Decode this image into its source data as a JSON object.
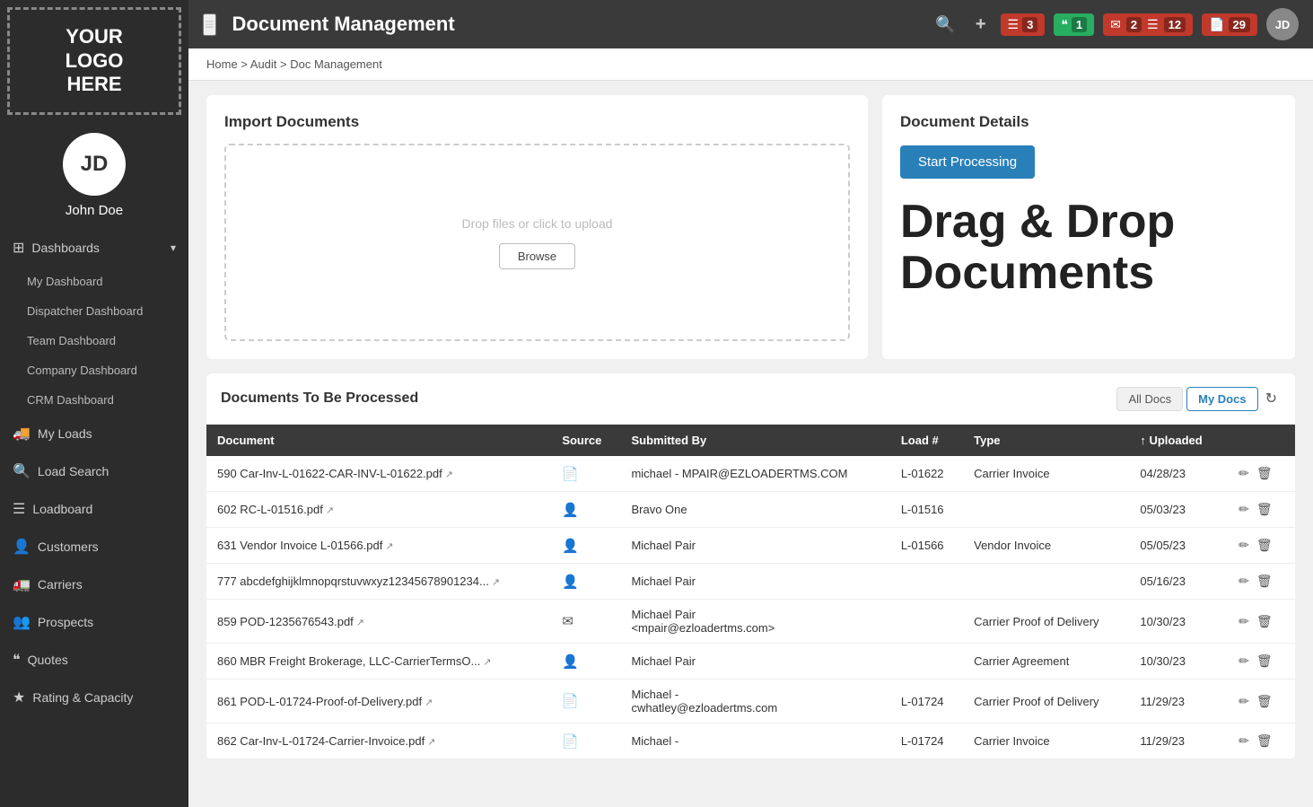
{
  "sidebar": {
    "logo": "YOUR\nLOGO\nHERE",
    "user": {
      "initials": "JD",
      "name": "John Doe"
    },
    "nav": [
      {
        "id": "dashboards",
        "icon": "grid",
        "label": "Dashboards",
        "hasChevron": true,
        "expanded": true,
        "subItems": [
          {
            "id": "my-dashboard",
            "label": "My Dashboard"
          },
          {
            "id": "dispatcher-dashboard",
            "label": "Dispatcher Dashboard"
          },
          {
            "id": "team-dashboard",
            "label": "Team Dashboard"
          },
          {
            "id": "company-dashboard",
            "label": "Company Dashboard"
          },
          {
            "id": "crm-dashboard",
            "label": "CRM Dashboard"
          }
        ]
      },
      {
        "id": "my-loads",
        "icon": "truck",
        "label": "My Loads"
      },
      {
        "id": "load-search",
        "icon": "search",
        "label": "Load Search"
      },
      {
        "id": "loadboard",
        "icon": "list",
        "label": "Loadboard"
      },
      {
        "id": "customers",
        "icon": "user",
        "label": "Customers"
      },
      {
        "id": "carriers",
        "icon": "truck2",
        "label": "Carriers"
      },
      {
        "id": "prospects",
        "icon": "users",
        "label": "Prospects"
      },
      {
        "id": "quotes",
        "icon": "quote",
        "label": "Quotes"
      },
      {
        "id": "rating-capacity",
        "icon": "star",
        "label": "Rating & Capacity"
      }
    ]
  },
  "topbar": {
    "hamburger_label": "≡",
    "page_title": "Document Management",
    "search_icon": "🔍",
    "add_icon": "+",
    "badge_groups": [
      {
        "id": "list-badge",
        "icon": "≡",
        "count": "3",
        "color": "red"
      },
      {
        "id": "quote-badge",
        "icon": "❝",
        "count": "1",
        "color": "green"
      },
      {
        "id": "email-badge",
        "icon": "✉",
        "count": "2",
        "color": "red"
      },
      {
        "id": "doc-badge",
        "icon": "≡",
        "count": "12",
        "color": "red"
      },
      {
        "id": "paper-badge",
        "icon": "📄",
        "count": "29",
        "color": "red"
      }
    ],
    "user_initials": "JD"
  },
  "breadcrumb": "Home > Audit > Doc Management",
  "import_panel": {
    "title": "Import Documents",
    "drop_label": "Drop files or click to upload",
    "browse_btn": "Browse"
  },
  "doc_details_panel": {
    "title": "Document Details",
    "start_processing_btn": "Start Processing",
    "promo_text": "Drag & Drop\nDocuments"
  },
  "docs_table": {
    "title": "Documents To Be Processed",
    "filter_all": "All Docs",
    "filter_mine": "My Docs",
    "columns": [
      "Document",
      "Source",
      "Submitted By",
      "Load #",
      "Type",
      "↑ Uploaded"
    ],
    "rows": [
      {
        "id": "row-1",
        "document": "590 Car-Inv-L-01622-CAR-INV-L-01622.pdf",
        "source": "doc",
        "submitted_by": "michael - MPAIR@EZLOADERTMS.COM",
        "load_num": "L-01622",
        "type": "Carrier Invoice",
        "uploaded": "04/28/23"
      },
      {
        "id": "row-2",
        "document": "602 RC-L-01516.pdf",
        "source": "person",
        "submitted_by": "Bravo One",
        "load_num": "L-01516",
        "type": "",
        "uploaded": "05/03/23"
      },
      {
        "id": "row-3",
        "document": "631 Vendor Invoice L-01566.pdf",
        "source": "person",
        "submitted_by": "Michael Pair",
        "load_num": "L-01566",
        "type": "Vendor Invoice",
        "uploaded": "05/05/23"
      },
      {
        "id": "row-4",
        "document": "777 abcdefghijklmnopqrstuvwxyz12345678901234...",
        "source": "person",
        "submitted_by": "Michael Pair",
        "load_num": "",
        "type": "",
        "uploaded": "05/16/23"
      },
      {
        "id": "row-5",
        "document": "859 POD-1235676543.pdf",
        "source": "email",
        "submitted_by": "Michael Pair\n<mpair@ezloadertms.com>",
        "load_num": "",
        "type": "Carrier Proof of Delivery",
        "uploaded": "10/30/23"
      },
      {
        "id": "row-6",
        "document": "860 MBR Freight Brokerage, LLC-CarrierTermsO...",
        "source": "person",
        "submitted_by": "Michael Pair",
        "load_num": "",
        "type": "Carrier Agreement",
        "uploaded": "10/30/23"
      },
      {
        "id": "row-7",
        "document": "861 POD-L-01724-Proof-of-Delivery.pdf",
        "source": "doc",
        "submitted_by": "Michael -\ncwhatley@ezloadertms.com",
        "load_num": "L-01724",
        "type": "Carrier Proof of Delivery",
        "uploaded": "11/29/23"
      },
      {
        "id": "row-8",
        "document": "862 Car-Inv-L-01724-Carrier-Invoice.pdf",
        "source": "doc",
        "submitted_by": "Michael -",
        "load_num": "L-01724",
        "type": "Carrier Invoice",
        "uploaded": "11/29/23"
      }
    ]
  }
}
